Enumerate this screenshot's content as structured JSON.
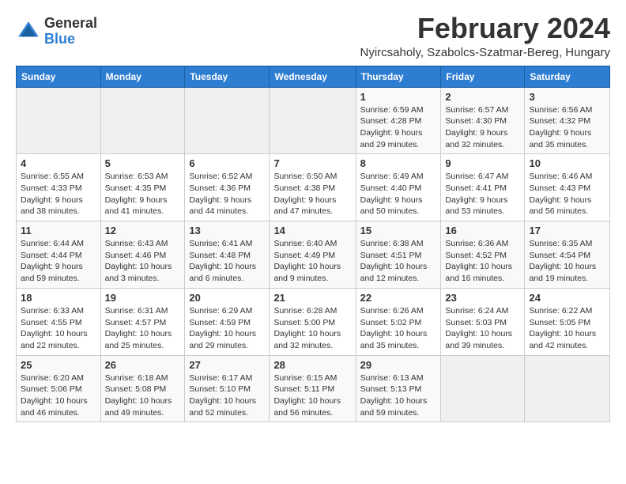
{
  "logo": {
    "general": "General",
    "blue": "Blue"
  },
  "title": "February 2024",
  "location": "Nyircsaholy, Szabolcs-Szatmar-Bereg, Hungary",
  "weekdays": [
    "Sunday",
    "Monday",
    "Tuesday",
    "Wednesday",
    "Thursday",
    "Friday",
    "Saturday"
  ],
  "weeks": [
    [
      {
        "day": "",
        "info": ""
      },
      {
        "day": "",
        "info": ""
      },
      {
        "day": "",
        "info": ""
      },
      {
        "day": "",
        "info": ""
      },
      {
        "day": "1",
        "info": "Sunrise: 6:59 AM\nSunset: 4:28 PM\nDaylight: 9 hours\nand 29 minutes."
      },
      {
        "day": "2",
        "info": "Sunrise: 6:57 AM\nSunset: 4:30 PM\nDaylight: 9 hours\nand 32 minutes."
      },
      {
        "day": "3",
        "info": "Sunrise: 6:56 AM\nSunset: 4:32 PM\nDaylight: 9 hours\nand 35 minutes."
      }
    ],
    [
      {
        "day": "4",
        "info": "Sunrise: 6:55 AM\nSunset: 4:33 PM\nDaylight: 9 hours\nand 38 minutes."
      },
      {
        "day": "5",
        "info": "Sunrise: 6:53 AM\nSunset: 4:35 PM\nDaylight: 9 hours\nand 41 minutes."
      },
      {
        "day": "6",
        "info": "Sunrise: 6:52 AM\nSunset: 4:36 PM\nDaylight: 9 hours\nand 44 minutes."
      },
      {
        "day": "7",
        "info": "Sunrise: 6:50 AM\nSunset: 4:38 PM\nDaylight: 9 hours\nand 47 minutes."
      },
      {
        "day": "8",
        "info": "Sunrise: 6:49 AM\nSunset: 4:40 PM\nDaylight: 9 hours\nand 50 minutes."
      },
      {
        "day": "9",
        "info": "Sunrise: 6:47 AM\nSunset: 4:41 PM\nDaylight: 9 hours\nand 53 minutes."
      },
      {
        "day": "10",
        "info": "Sunrise: 6:46 AM\nSunset: 4:43 PM\nDaylight: 9 hours\nand 56 minutes."
      }
    ],
    [
      {
        "day": "11",
        "info": "Sunrise: 6:44 AM\nSunset: 4:44 PM\nDaylight: 9 hours\nand 59 minutes."
      },
      {
        "day": "12",
        "info": "Sunrise: 6:43 AM\nSunset: 4:46 PM\nDaylight: 10 hours\nand 3 minutes."
      },
      {
        "day": "13",
        "info": "Sunrise: 6:41 AM\nSunset: 4:48 PM\nDaylight: 10 hours\nand 6 minutes."
      },
      {
        "day": "14",
        "info": "Sunrise: 6:40 AM\nSunset: 4:49 PM\nDaylight: 10 hours\nand 9 minutes."
      },
      {
        "day": "15",
        "info": "Sunrise: 6:38 AM\nSunset: 4:51 PM\nDaylight: 10 hours\nand 12 minutes."
      },
      {
        "day": "16",
        "info": "Sunrise: 6:36 AM\nSunset: 4:52 PM\nDaylight: 10 hours\nand 16 minutes."
      },
      {
        "day": "17",
        "info": "Sunrise: 6:35 AM\nSunset: 4:54 PM\nDaylight: 10 hours\nand 19 minutes."
      }
    ],
    [
      {
        "day": "18",
        "info": "Sunrise: 6:33 AM\nSunset: 4:55 PM\nDaylight: 10 hours\nand 22 minutes."
      },
      {
        "day": "19",
        "info": "Sunrise: 6:31 AM\nSunset: 4:57 PM\nDaylight: 10 hours\nand 25 minutes."
      },
      {
        "day": "20",
        "info": "Sunrise: 6:29 AM\nSunset: 4:59 PM\nDaylight: 10 hours\nand 29 minutes."
      },
      {
        "day": "21",
        "info": "Sunrise: 6:28 AM\nSunset: 5:00 PM\nDaylight: 10 hours\nand 32 minutes."
      },
      {
        "day": "22",
        "info": "Sunrise: 6:26 AM\nSunset: 5:02 PM\nDaylight: 10 hours\nand 35 minutes."
      },
      {
        "day": "23",
        "info": "Sunrise: 6:24 AM\nSunset: 5:03 PM\nDaylight: 10 hours\nand 39 minutes."
      },
      {
        "day": "24",
        "info": "Sunrise: 6:22 AM\nSunset: 5:05 PM\nDaylight: 10 hours\nand 42 minutes."
      }
    ],
    [
      {
        "day": "25",
        "info": "Sunrise: 6:20 AM\nSunset: 5:06 PM\nDaylight: 10 hours\nand 46 minutes."
      },
      {
        "day": "26",
        "info": "Sunrise: 6:18 AM\nSunset: 5:08 PM\nDaylight: 10 hours\nand 49 minutes."
      },
      {
        "day": "27",
        "info": "Sunrise: 6:17 AM\nSunset: 5:10 PM\nDaylight: 10 hours\nand 52 minutes."
      },
      {
        "day": "28",
        "info": "Sunrise: 6:15 AM\nSunset: 5:11 PM\nDaylight: 10 hours\nand 56 minutes."
      },
      {
        "day": "29",
        "info": "Sunrise: 6:13 AM\nSunset: 5:13 PM\nDaylight: 10 hours\nand 59 minutes."
      },
      {
        "day": "",
        "info": ""
      },
      {
        "day": "",
        "info": ""
      }
    ]
  ]
}
